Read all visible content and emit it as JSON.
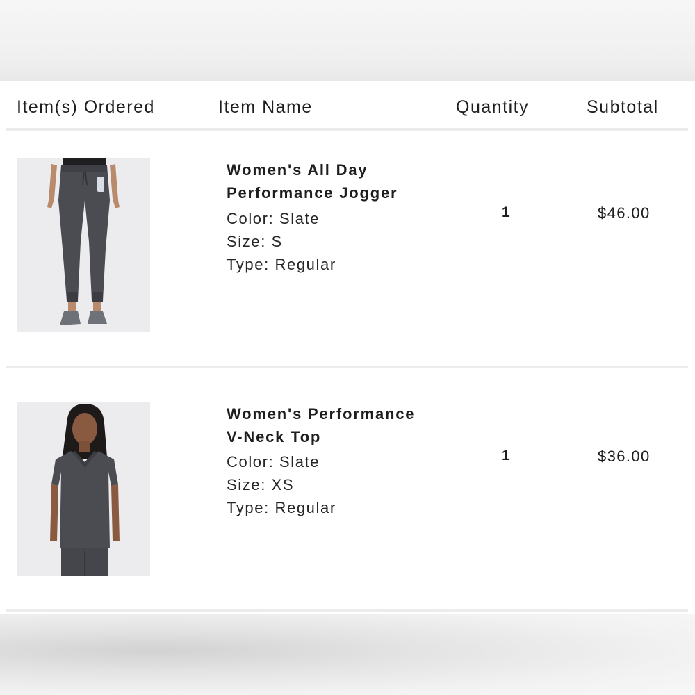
{
  "table": {
    "headers": {
      "items_ordered": "Item(s) Ordered",
      "item_name": "Item Name",
      "quantity": "Quantity",
      "subtotal": "Subtotal"
    },
    "rows": [
      {
        "image_icon": "jogger-pants-photo",
        "name_line1": "Women's All Day",
        "name_line2": "Performance Jogger",
        "color": "Color: Slate",
        "size": "Size: S",
        "type": "Type: Regular",
        "quantity": "1",
        "subtotal": "$46.00"
      },
      {
        "image_icon": "vneck-top-photo",
        "name_line1": "Women's Performance",
        "name_line2": "V-Neck Top",
        "color": "Color: Slate",
        "size": "Size: XS",
        "type": "Type: Regular",
        "quantity": "1",
        "subtotal": "$36.00"
      }
    ]
  },
  "colors": {
    "product_slate": "#4a4c52",
    "divider": "#ececec",
    "text": "#1e1e1e"
  }
}
